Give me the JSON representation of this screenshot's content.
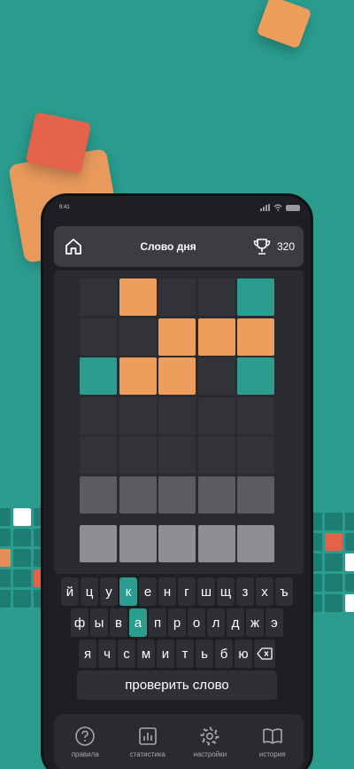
{
  "status": {
    "time": "9:41"
  },
  "header": {
    "title": "Слово дня",
    "score": "320"
  },
  "board": {
    "rows": [
      [
        "empty",
        "orange",
        "empty",
        "empty",
        "teal"
      ],
      [
        "empty",
        "empty",
        "orange",
        "orange",
        "orange"
      ],
      [
        "teal",
        "orange",
        "orange",
        "empty",
        "teal"
      ],
      [
        "empty",
        "empty",
        "empty",
        "empty",
        "empty"
      ],
      [
        "empty",
        "empty",
        "empty",
        "empty",
        "empty"
      ],
      [
        "grey",
        "grey",
        "grey",
        "grey",
        "grey"
      ]
    ],
    "input": [
      "",
      "",
      "",
      "",
      ""
    ]
  },
  "keyboard": {
    "row1": [
      "й",
      "ц",
      "у",
      "к",
      "е",
      "н",
      "г",
      "ш",
      "щ",
      "з",
      "х",
      "ъ"
    ],
    "row2": [
      "ф",
      "ы",
      "в",
      "а",
      "п",
      "р",
      "о",
      "л",
      "д",
      "ж",
      "э"
    ],
    "row3": [
      "я",
      "ч",
      "с",
      "м",
      "и",
      "т",
      "ь",
      "б",
      "ю"
    ],
    "highlighted": [
      "к",
      "а"
    ],
    "submit_label": "проверить слово"
  },
  "tabs": [
    {
      "label": "правила",
      "icon": "help-icon"
    },
    {
      "label": "статистика",
      "icon": "stats-icon"
    },
    {
      "label": "настройки",
      "icon": "gear-icon"
    },
    {
      "label": "история",
      "icon": "book-icon"
    }
  ],
  "colors": {
    "background": "#2a9d8f",
    "orange": "#ee9e5c",
    "teal": "#2a9d8f",
    "tile": "#323338"
  }
}
